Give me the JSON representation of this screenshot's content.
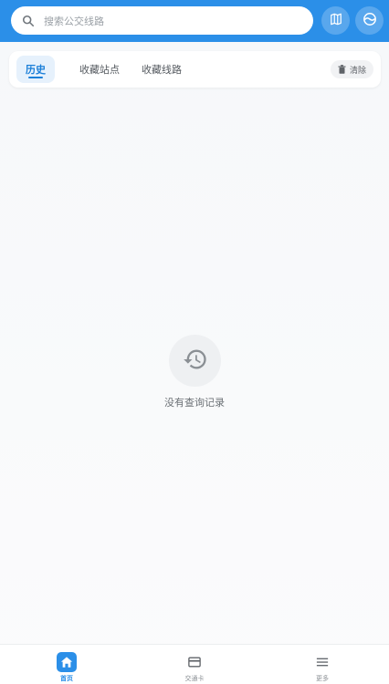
{
  "header": {
    "search_placeholder": "搜索公交线路",
    "search_icon": "search-icon",
    "map_button_icon": "map-icon",
    "metro_button_icon": "metro-icon",
    "accent_color": "#2b8fe8"
  },
  "tabs": [
    {
      "label": "历史",
      "active": true
    },
    {
      "label": "收藏站点",
      "active": false
    },
    {
      "label": "收藏线路",
      "active": false
    }
  ],
  "clear_button": {
    "label": "清除",
    "icon": "trash-icon"
  },
  "empty_state": {
    "icon": "history-icon",
    "text": "没有查询记录"
  },
  "bottom_nav": [
    {
      "label": "首页",
      "icon": "home-icon",
      "active": true
    },
    {
      "label": "交通卡",
      "icon": "card-icon",
      "active": false
    },
    {
      "label": "更多",
      "icon": "menu-icon",
      "active": false
    }
  ]
}
